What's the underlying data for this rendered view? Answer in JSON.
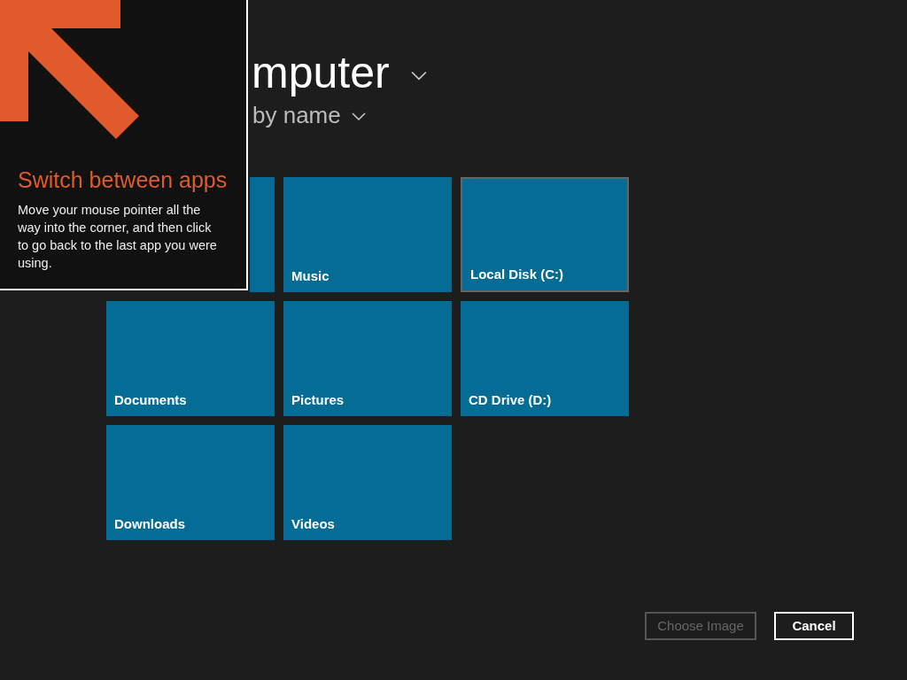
{
  "header": {
    "title": "mputer",
    "sort": "by name"
  },
  "tiles": [
    {
      "selected": false
    },
    {
      "label": "Music",
      "selected": false
    },
    {
      "label": "Local Disk (C:)",
      "selected": true
    },
    {
      "label": "Documents",
      "selected": false
    },
    {
      "label": "Pictures",
      "selected": false
    },
    {
      "label": "CD Drive (D:)",
      "selected": false
    },
    {
      "label": "Downloads",
      "selected": false
    },
    {
      "label": "Videos",
      "selected": false
    }
  ],
  "buttons": [
    {
      "label": "Choose Image",
      "disabled": true
    },
    {
      "label": "Cancel",
      "disabled": false
    }
  ],
  "tip": {
    "title": "Switch between apps",
    "body": "Move your mouse pointer all the way into the corner, and then click to go back to the last app you were using."
  }
}
